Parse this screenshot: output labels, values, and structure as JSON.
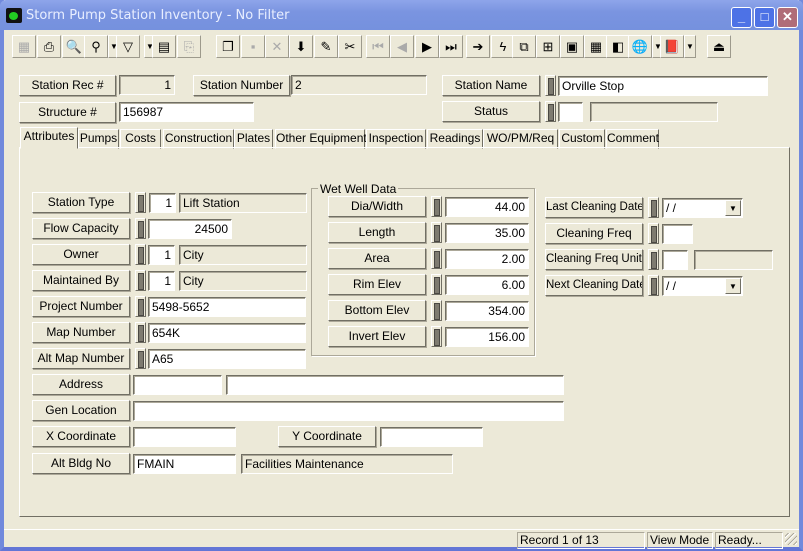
{
  "window": {
    "title": "Storm Pump Station Inventory - No Filter",
    "controls": {
      "minimize": "_",
      "maximize": "□",
      "close": "✕"
    }
  },
  "toolbar": {
    "buttons": [
      {
        "name": "form-view-icon",
        "glyph": "▦",
        "enabled": false
      },
      {
        "name": "print-icon",
        "glyph": "⎙",
        "enabled": true
      },
      {
        "name": "print-preview-icon",
        "glyph": "🔍",
        "enabled": true
      },
      {
        "name": "find-icon",
        "glyph": "⚲",
        "enabled": true
      },
      {
        "name": "filter-icon",
        "glyph": "▽",
        "enabled": true
      },
      {
        "name": "report-icon",
        "glyph": "▤",
        "enabled": true
      },
      {
        "name": "export-icon",
        "glyph": "⎘",
        "enabled": false
      },
      {
        "name": "copy-record-icon",
        "glyph": "❐",
        "enabled": true
      },
      {
        "name": "save-icon",
        "glyph": "▪",
        "enabled": false
      },
      {
        "name": "delete-icon",
        "glyph": "✕",
        "enabled": false
      },
      {
        "name": "add-record-icon",
        "glyph": "⬇",
        "enabled": true
      },
      {
        "name": "edit-icon",
        "glyph": "✎",
        "enabled": true
      },
      {
        "name": "cut-icon",
        "glyph": "✂",
        "enabled": true
      },
      {
        "name": "first-record-icon",
        "glyph": "⏮",
        "enabled": false
      },
      {
        "name": "previous-record-icon",
        "glyph": "◀",
        "enabled": false
      },
      {
        "name": "next-record-icon",
        "glyph": "▶",
        "enabled": true
      },
      {
        "name": "last-record-icon",
        "glyph": "⏭",
        "enabled": true
      },
      {
        "name": "goto-icon",
        "glyph": "➔",
        "enabled": true
      },
      {
        "name": "quick-action-icon",
        "glyph": "ϟ",
        "enabled": true
      },
      {
        "name": "related-records-icon",
        "glyph": "⧉",
        "enabled": true
      },
      {
        "name": "hierarchy-icon",
        "glyph": "⊞",
        "enabled": true
      },
      {
        "name": "equipment-icon",
        "glyph": "▣",
        "enabled": true
      },
      {
        "name": "calculator-icon",
        "glyph": "▦",
        "enabled": true
      },
      {
        "name": "map-icon",
        "glyph": "◧",
        "enabled": true
      },
      {
        "name": "gis-globe-icon",
        "glyph": "🌐",
        "enabled": true
      },
      {
        "name": "book-icon",
        "glyph": "📕",
        "enabled": true
      },
      {
        "name": "exit-icon",
        "glyph": "⏏",
        "enabled": true
      }
    ]
  },
  "header": {
    "station_rec_label": "Station Rec #",
    "station_rec_value": "1",
    "station_number_label": "Station Number",
    "station_number_value": "2",
    "station_name_label": "Station Name",
    "station_name_value": "Orville Stop",
    "structure_label": "Structure #",
    "structure_value": "156987",
    "status_label": "Status",
    "status_code": "",
    "status_desc": ""
  },
  "tabs": [
    "Attributes",
    "Pumps",
    "Costs",
    "Construction",
    "Plates",
    "Other Equipment",
    "Inspection",
    "Readings",
    "WO/PM/Req",
    "Custom",
    "Comment"
  ],
  "attributes": {
    "station_type_label": "Station Type",
    "station_type_code": "1",
    "station_type_desc": "Lift Station",
    "flow_capacity_label": "Flow Capacity",
    "flow_capacity_value": "24500",
    "owner_label": "Owner",
    "owner_code": "1",
    "owner_desc": "City",
    "maintained_by_label": "Maintained By",
    "maintained_by_code": "1",
    "maintained_by_desc": "City",
    "project_number_label": "Project Number",
    "project_number_value": "5498-5652",
    "map_number_label": "Map Number",
    "map_number_value": "654K",
    "alt_map_number_label": "Alt Map Number",
    "alt_map_number_value": "A65",
    "address_label": "Address",
    "address_number": "",
    "address_street": "",
    "gen_location_label": "Gen Location",
    "gen_location_value": "",
    "x_coordinate_label": "X Coordinate",
    "x_coordinate_value": "",
    "y_coordinate_label": "Y Coordinate",
    "y_coordinate_value": "",
    "alt_bldg_label": "Alt Bldg No",
    "alt_bldg_code": "FMAIN",
    "alt_bldg_desc": "Facilities Maintenance"
  },
  "wet_well": {
    "legend": "Wet Well Data",
    "rows": [
      {
        "label": "Dia/Width",
        "value": "44.00"
      },
      {
        "label": "Length",
        "value": "35.00"
      },
      {
        "label": "Area",
        "value": "2.00"
      },
      {
        "label": "Rim Elev",
        "value": "6.00"
      },
      {
        "label": "Bottom Elev",
        "value": "354.00"
      },
      {
        "label": "Invert Elev",
        "value": "156.00"
      }
    ]
  },
  "cleaning": {
    "last_cleaning_label": "Last Cleaning Date",
    "last_cleaning_value": " / /",
    "freq_label": "Cleaning Freq",
    "freq_value": "",
    "freq_units_label": "Cleaning Freq Units",
    "freq_units_code": "",
    "freq_units_desc": "",
    "next_cleaning_label": "Next Cleaning Date",
    "next_cleaning_value": " / /",
    "dropdown_glyph": "▼"
  },
  "status_bar": {
    "record": "Record 1 of 13",
    "mode": "View Mode",
    "state": "Ready..."
  }
}
